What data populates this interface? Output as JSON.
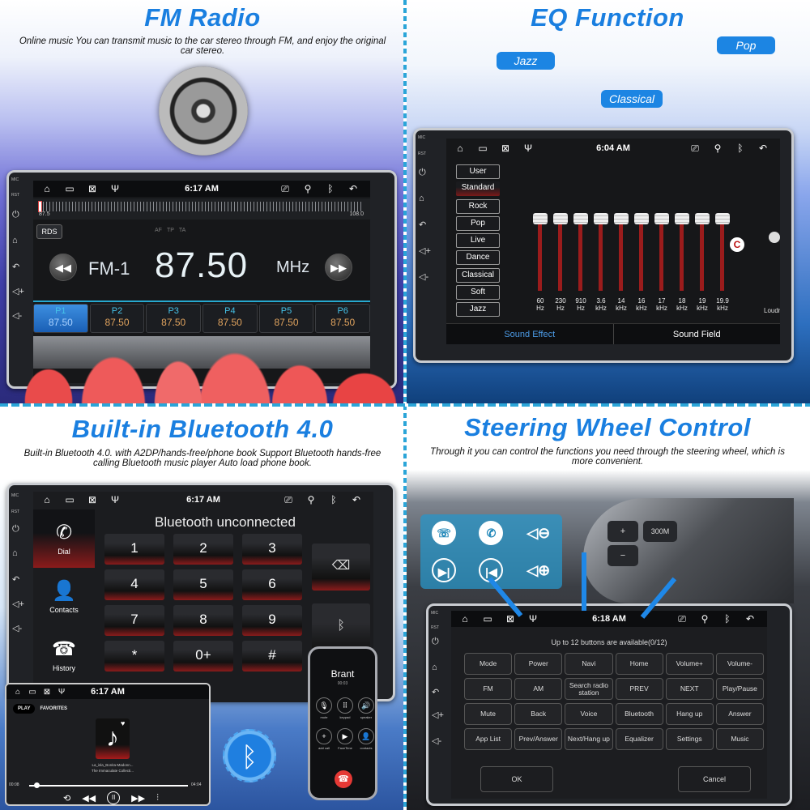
{
  "colors": {
    "title_blue": "#1a7fe0",
    "accent_cyan": "#27a9d0",
    "preset_freq": "#e0a35e",
    "eq_track": "#9b1c1c"
  },
  "fm": {
    "title": "FM Radio",
    "subtitle": "Online music You can transmit music to the car stereo through FM, and enjoy the original car stereo.",
    "device": {
      "side_keys": {
        "mic": "MIC",
        "rst": "RST",
        "power": "⏻",
        "home": "⌂",
        "back": "↶",
        "vol_up": "◁+",
        "vol_down": "◁-"
      },
      "status": {
        "time": "6:17 AM",
        "icons_left": [
          "⌂",
          "▭",
          "⊠",
          "Ψ"
        ],
        "icons_right": [
          "⎚",
          "⚲",
          "ᛒ",
          "↶"
        ]
      },
      "tuner": {
        "min": "87.5",
        "max": "108.0"
      },
      "rds_label": "RDS",
      "flags": [
        "AF",
        "TP",
        "TA"
      ],
      "band": "FM-1",
      "frequency": "87.50",
      "unit": "MHz",
      "prev_icon": "◀◀",
      "next_icon": "▶▶",
      "presets": [
        {
          "name": "P1",
          "freq": "87.50"
        },
        {
          "name": "P2",
          "freq": "87.50"
        },
        {
          "name": "P3",
          "freq": "87.50"
        },
        {
          "name": "P4",
          "freq": "87.50"
        },
        {
          "name": "P5",
          "freq": "87.50"
        },
        {
          "name": "P6",
          "freq": "87.50"
        }
      ]
    }
  },
  "eq": {
    "title": "EQ Function",
    "pills": {
      "jazz": "Jazz",
      "pop": "Pop",
      "classical": "Classical"
    },
    "device": {
      "side_keys": {
        "mic": "MIC",
        "rst": "RST",
        "power": "⏻",
        "home": "⌂",
        "back": "↶",
        "vol_up": "◁+",
        "vol_down": "◁-"
      },
      "status": {
        "time": "6:04 AM",
        "icons_left": [
          "⌂",
          "▭",
          "⊠",
          "Ψ"
        ],
        "icons_right": [
          "⎚",
          "⚲",
          "ᛒ",
          "↶"
        ]
      },
      "presets": [
        "User",
        "Standard",
        "Rock",
        "Pop",
        "Live",
        "Dance",
        "Classical",
        "Soft",
        "Jazz"
      ],
      "selected_preset": "Standard",
      "bands": [
        {
          "freq": "60",
          "unit": "Hz"
        },
        {
          "freq": "230",
          "unit": "Hz"
        },
        {
          "freq": "910",
          "unit": "Hz"
        },
        {
          "freq": "3.6",
          "unit": "kHz"
        },
        {
          "freq": "14",
          "unit": "kHz"
        },
        {
          "freq": "16",
          "unit": "kHz"
        },
        {
          "freq": "17",
          "unit": "kHz"
        },
        {
          "freq": "18",
          "unit": "kHz"
        },
        {
          "freq": "19",
          "unit": "kHz"
        },
        {
          "freq": "19.9",
          "unit": "kHz"
        }
      ],
      "band_level_fraction": 1.0,
      "loudness_label": "Loudness",
      "reset_icon": "C",
      "tabs": [
        "Sound Effect",
        "Sound Field"
      ],
      "active_tab": "Sound Effect"
    }
  },
  "bt": {
    "title": "Built-in Bluetooth 4.0",
    "subtitle": "Built-in Bluetooth 4.0. with A2DP/hands-free/phone book Support Bluetooth hands-free calling Bluetooth music player Auto load phone book.",
    "device": {
      "side_keys": {
        "mic": "MIC",
        "rst": "RST",
        "power": "⏻",
        "home": "⌂",
        "back": "↶",
        "vol_up": "◁+",
        "vol_down": "◁-"
      },
      "status": {
        "time": "6:17 AM",
        "icons_left": [
          "⌂",
          "▭",
          "⊠",
          "Ψ"
        ],
        "icons_right": [
          "⎚",
          "⚲",
          "ᛒ",
          "↶"
        ]
      },
      "heading": "Bluetooth unconnected",
      "nav": [
        {
          "label": "Dial",
          "icon": "✆"
        },
        {
          "label": "Contacts",
          "icon": "👤"
        },
        {
          "label": "History",
          "icon": "☎"
        }
      ],
      "keys": [
        "1",
        "2",
        "3",
        "4",
        "5",
        "6",
        "7",
        "8",
        "9",
        "*",
        "0+",
        "#"
      ],
      "backspace_icon": "⌫",
      "bt_icon": "ᛒ"
    },
    "music_player": {
      "status": {
        "time": "6:17 AM"
      },
      "tabs": [
        "PLAY",
        "FAVORITES"
      ],
      "track_title": "La_isla_Bonita-Madonn...",
      "track_album": "The Immaculate Collecti...",
      "time_current": "00:08",
      "time_total": "04:04",
      "progress_fraction": 0.03,
      "controls": [
        "⟲",
        "◀◀",
        "II",
        "▶▶",
        "⫶"
      ]
    },
    "phone": {
      "caller": "Brant",
      "duration": "00:03",
      "buttons": [
        {
          "icon": "🎙",
          "label": "mute"
        },
        {
          "icon": "⠿",
          "label": "keypad"
        },
        {
          "icon": "🔊",
          "label": "speaker"
        },
        {
          "icon": "+",
          "label": "add call"
        },
        {
          "icon": "▶",
          "label": "FaceTime"
        },
        {
          "icon": "👤",
          "label": "contacts"
        }
      ],
      "hangup_icon": "☎"
    }
  },
  "swc": {
    "title": "Steering Wheel Control",
    "subtitle": "Through it you can control the functions you need through the steering wheel, which is more convenient.",
    "overlay_icons": [
      "hang-up",
      "answer",
      "volume-down",
      "next-track",
      "previous-track",
      "volume-up"
    ],
    "wheel_labels": {
      "mode": "300M",
      "plus": "+",
      "minus": "−"
    },
    "device": {
      "side_keys": {
        "mic": "MIC",
        "rst": "RST",
        "power": "⏻",
        "home": "⌂",
        "back": "↶",
        "vol_up": "◁+",
        "vol_down": "◁-"
      },
      "status": {
        "time": "6:18 AM",
        "icons_left": [
          "⌂",
          "▭",
          "⊠",
          "Ψ"
        ],
        "icons_right": [
          "⎚",
          "⚲",
          "ᛒ",
          "↶"
        ]
      },
      "hint": "Up to 12 buttons are available(0/12)",
      "buttons": [
        "Mode",
        "Power",
        "Navi",
        "Home",
        "Volume+",
        "Volume-",
        "FM",
        "AM",
        "Search radio station",
        "PREV",
        "NEXT",
        "Play/Pause",
        "Mute",
        "Back",
        "Voice",
        "Bluetooth",
        "Hang up",
        "Answer",
        "App List",
        "Prev/Answer",
        "Next/Hang up",
        "Equalizer",
        "Settings",
        "Music"
      ],
      "ok": "OK",
      "cancel": "Cancel"
    }
  }
}
